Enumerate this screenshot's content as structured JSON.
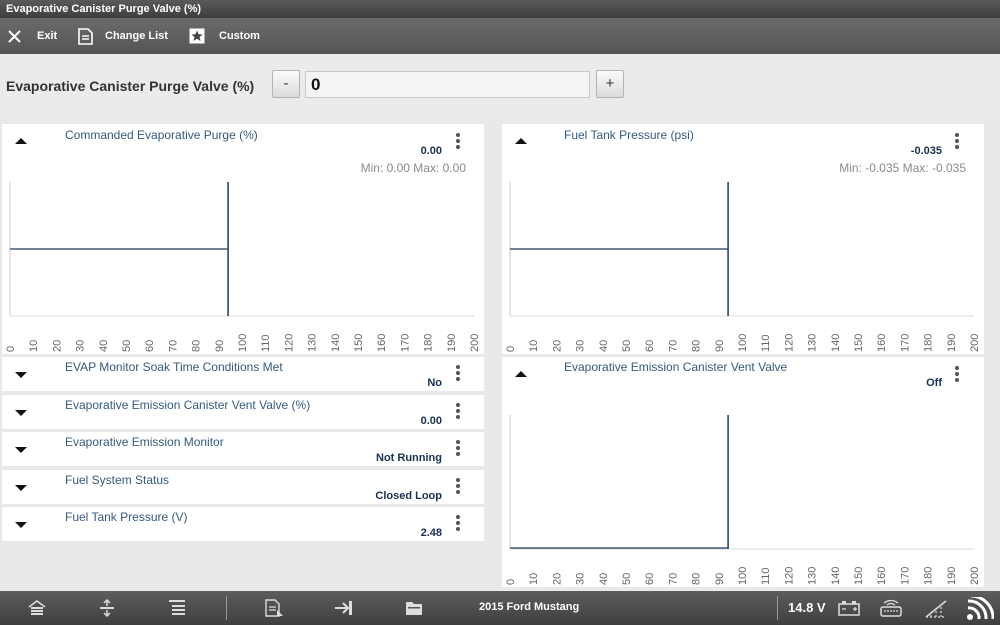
{
  "window": {
    "title": "Evaporative Canister Purge Valve (%)"
  },
  "toolbar": {
    "exit_label": "Exit",
    "change_list_label": "Change List",
    "custom_label": "Custom"
  },
  "control": {
    "label": "Evaporative Canister Purge Valve (%)",
    "minus_label": "-",
    "value": "0",
    "plus_label": "+"
  },
  "graph_axis_ticks": [
    "0",
    "10",
    "20",
    "30",
    "40",
    "50",
    "60",
    "70",
    "80",
    "90",
    "100",
    "110",
    "120",
    "130",
    "140",
    "150",
    "160",
    "170",
    "180",
    "190",
    "200"
  ],
  "panels": {
    "commanded_purge": {
      "title": "Commanded Evaporative Purge (%)",
      "value": "0.00",
      "minmax": "Min: 0.00    Max: 0.00"
    },
    "fuel_tank_pressure_psi": {
      "title": "Fuel Tank Pressure (psi)",
      "value": "-0.035",
      "minmax": "Min: -0.035    Max: -0.035"
    },
    "vent_valve": {
      "title": "Evaporative Emission Canister Vent Valve",
      "value": "Off"
    }
  },
  "rows": [
    {
      "title": "EVAP Monitor Soak Time Conditions Met",
      "value": "No"
    },
    {
      "title": "Evaporative Emission Canister Vent Valve (%)",
      "value": "0.00"
    },
    {
      "title": "Evaporative Emission Monitor",
      "value": "Not Running"
    },
    {
      "title": "Fuel System Status",
      "value": "Closed Loop"
    },
    {
      "title": "Fuel Tank Pressure (V)",
      "value": "2.48"
    }
  ],
  "status": {
    "vehicle": "2015 Ford Mustang",
    "voltage": "14.8 V"
  },
  "icons": [
    "close-icon",
    "document-icon",
    "star-icon",
    "home-icon",
    "expand-icon",
    "collapse-icon",
    "report-icon",
    "exit-arrow-icon",
    "folder-icon",
    "battery-icon",
    "scanner-icon",
    "no-signal-icon",
    "wifi-icon"
  ]
}
